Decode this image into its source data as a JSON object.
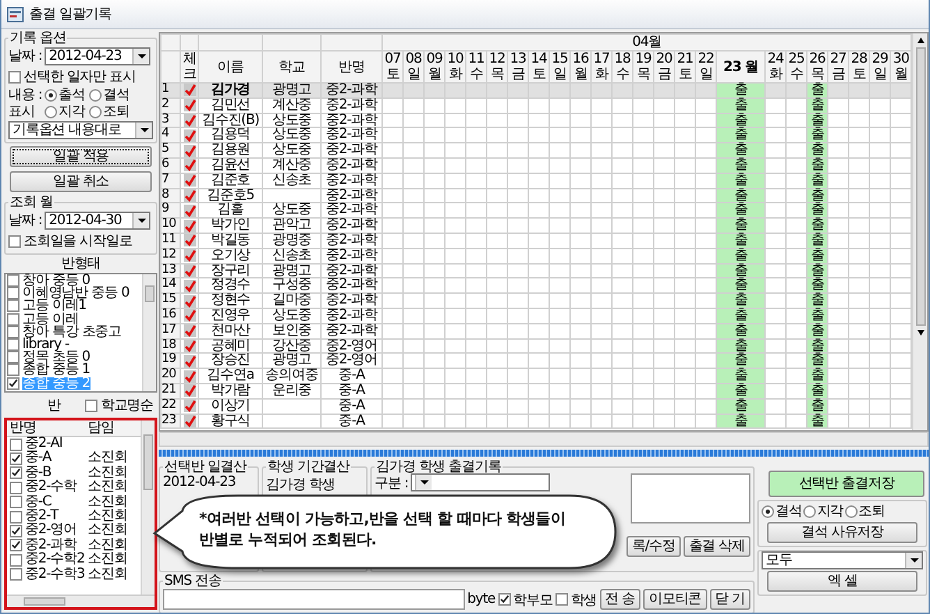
{
  "window": {
    "title": "출결 일괄기록"
  },
  "record_options": {
    "title": "기록 옵션",
    "date_label": "날짜 :",
    "date": "2012-04-23",
    "only_selected": {
      "label": "선택한 일자만 표시",
      "checked": false
    },
    "content_label": "내용 :",
    "display_label": "표시",
    "radios": [
      {
        "label": "출석",
        "selected": true
      },
      {
        "label": "결석",
        "selected": false
      },
      {
        "label": "지각",
        "selected": false
      },
      {
        "label": "조퇴",
        "selected": false
      }
    ],
    "mode": "기록옵션 내용대로"
  },
  "batch_buttons": [
    {
      "label": "일괄 적용",
      "focused": true
    },
    {
      "label": "일괄 취소",
      "focused": false
    }
  ],
  "query_month": {
    "title": "조회 월",
    "date_label": "날짜 :",
    "date": "2012-04-30",
    "start_option": {
      "label": "조회일을 시작일로",
      "checked": false
    }
  },
  "class_types": {
    "title": "반형태",
    "items": [
      {
        "label": "창아 중등 0",
        "checked": false,
        "selected": false
      },
      {
        "label": "이혜영남반 중등 0",
        "checked": false,
        "selected": false
      },
      {
        "label": "고등 이레1",
        "checked": false,
        "selected": false
      },
      {
        "label": "고등 이레",
        "checked": false,
        "selected": false
      },
      {
        "label": "창아 특강 초중고",
        "checked": false,
        "selected": false
      },
      {
        "label": "library -",
        "checked": false,
        "selected": false
      },
      {
        "label": "정목 초등 0",
        "checked": false,
        "selected": false
      },
      {
        "label": "종합 중등 1",
        "checked": false,
        "selected": false
      },
      {
        "label": "종합 중등 2",
        "checked": true,
        "selected": true
      }
    ]
  },
  "class_label": "반",
  "school_sort": {
    "label": "학교명순",
    "checked": false
  },
  "class_list": {
    "columns": [
      "반명",
      "담임"
    ],
    "rows": [
      {
        "name": "중2-AI",
        "checked": false
      },
      {
        "name": "중-A",
        "teacher": "소진회",
        "checked": true
      },
      {
        "name": "중-B",
        "teacher": "소진회",
        "checked": true
      },
      {
        "name": "중2-수학",
        "teacher": "소진회",
        "checked": false
      },
      {
        "name": "중-C",
        "teacher": "소진회",
        "checked": false
      },
      {
        "name": "중2-T",
        "teacher": "소진회",
        "checked": false
      },
      {
        "name": "중2-영어",
        "teacher": "소진회",
        "checked": true
      },
      {
        "name": "중2-과학",
        "teacher": "소진회",
        "checked": true
      },
      {
        "name": "중2-수학2",
        "teacher": "소진회",
        "checked": false
      },
      {
        "name": "중2-수학3",
        "teacher": "소진회",
        "checked": false
      }
    ]
  },
  "grid": {
    "month": "04월",
    "columns": [
      "체크",
      "이름",
      "학교",
      "반명"
    ],
    "days": [
      {
        "date": "07",
        "weekday": "토",
        "selected": false
      },
      {
        "date": "08",
        "weekday": "일",
        "selected": false
      },
      {
        "date": "09",
        "weekday": "월",
        "selected": false
      },
      {
        "date": "10",
        "weekday": "화",
        "selected": false
      },
      {
        "date": "11",
        "weekday": "수",
        "selected": false
      },
      {
        "date": "12",
        "weekday": "목",
        "selected": false
      },
      {
        "date": "13",
        "weekday": "금",
        "selected": false
      },
      {
        "date": "14",
        "weekday": "토",
        "selected": false
      },
      {
        "date": "15",
        "weekday": "일",
        "selected": false
      },
      {
        "date": "16",
        "weekday": "월",
        "selected": false
      },
      {
        "date": "17",
        "weekday": "화",
        "selected": false
      },
      {
        "date": "18",
        "weekday": "수",
        "selected": false
      },
      {
        "date": "19",
        "weekday": "목",
        "selected": false
      },
      {
        "date": "20",
        "weekday": "금",
        "selected": false
      },
      {
        "date": "21",
        "weekday": "토",
        "selected": false
      },
      {
        "date": "22",
        "weekday": "일",
        "selected": false
      },
      {
        "date": "23",
        "weekday": "월",
        "selected": true
      },
      {
        "date": "24",
        "weekday": "화",
        "selected": false
      },
      {
        "date": "25",
        "weekday": "수",
        "selected": false
      },
      {
        "date": "26",
        "weekday": "목",
        "selected": false
      },
      {
        "date": "27",
        "weekday": "금",
        "selected": false
      },
      {
        "date": "28",
        "weekday": "토",
        "selected": false
      },
      {
        "date": "29",
        "weekday": "일",
        "selected": false
      },
      {
        "date": "30",
        "weekday": "월",
        "selected": false
      }
    ],
    "rows": [
      {
        "number": "1",
        "checked": true,
        "name": "김가경",
        "school": "광명고",
        "class": "중2-과학",
        "selected": true,
        "cells": [
          null,
          null,
          null,
          null,
          null,
          null,
          null,
          null,
          null,
          null,
          null,
          null,
          null,
          null,
          null,
          null,
          "출",
          null,
          null,
          "출",
          null,
          null,
          null,
          null
        ]
      },
      {
        "number": "2",
        "checked": true,
        "name": "김민선",
        "school": "계산중",
        "class": "중2-과학",
        "selected": false,
        "cells": [
          null,
          null,
          null,
          null,
          null,
          null,
          null,
          null,
          null,
          null,
          null,
          null,
          null,
          null,
          null,
          null,
          "출",
          null,
          null,
          "출",
          null,
          null,
          null,
          null
        ]
      },
      {
        "number": "3",
        "checked": true,
        "name": "김수진(B)",
        "school": "상도중",
        "class": "중2-과학",
        "selected": false,
        "cells": [
          null,
          null,
          null,
          null,
          null,
          null,
          null,
          null,
          null,
          null,
          null,
          null,
          null,
          null,
          null,
          null,
          "출",
          null,
          null,
          "출",
          null,
          null,
          null,
          null
        ]
      },
      {
        "number": "4",
        "checked": true,
        "name": "김용덕",
        "school": "상도중",
        "class": "중2-과학",
        "selected": false,
        "cells": [
          null,
          null,
          null,
          null,
          null,
          null,
          null,
          null,
          null,
          null,
          null,
          null,
          null,
          null,
          null,
          null,
          "출",
          null,
          null,
          "출",
          null,
          null,
          null,
          null
        ]
      },
      {
        "number": "5",
        "checked": true,
        "name": "김용원",
        "school": "상도중",
        "class": "중2-과학",
        "selected": false,
        "cells": [
          null,
          null,
          null,
          null,
          null,
          null,
          null,
          null,
          null,
          null,
          null,
          null,
          null,
          null,
          null,
          null,
          "출",
          null,
          null,
          "출",
          null,
          null,
          null,
          null
        ]
      },
      {
        "number": "6",
        "checked": true,
        "name": "김윤선",
        "school": "계산중",
        "class": "중2-과학",
        "selected": false,
        "cells": [
          null,
          null,
          null,
          null,
          null,
          null,
          null,
          null,
          null,
          null,
          null,
          null,
          null,
          null,
          null,
          null,
          "출",
          null,
          null,
          "출",
          null,
          null,
          null,
          null
        ]
      },
      {
        "number": "7",
        "checked": true,
        "name": "김준호",
        "school": "신송초",
        "class": "중2-과학",
        "selected": false,
        "cells": [
          null,
          null,
          null,
          null,
          null,
          null,
          null,
          null,
          null,
          null,
          null,
          null,
          null,
          null,
          null,
          null,
          "출",
          null,
          null,
          "출",
          null,
          null,
          null,
          null
        ]
      },
      {
        "number": "8",
        "checked": true,
        "name": "김준호5",
        "class": "중2-과학",
        "selected": false,
        "cells": [
          null,
          null,
          null,
          null,
          null,
          null,
          null,
          null,
          null,
          null,
          null,
          null,
          null,
          null,
          null,
          null,
          "출",
          null,
          null,
          "출",
          null,
          null,
          null,
          null
        ]
      },
      {
        "number": "9",
        "checked": true,
        "name": "김홀",
        "school": "상도중",
        "class": "중2-과학",
        "selected": false,
        "cells": [
          null,
          null,
          null,
          null,
          null,
          null,
          null,
          null,
          null,
          null,
          null,
          null,
          null,
          null,
          null,
          null,
          "출",
          null,
          null,
          "출",
          null,
          null,
          null,
          null
        ]
      },
      {
        "number": "10",
        "checked": true,
        "name": "박가인",
        "school": "관악고",
        "class": "중2-과학",
        "selected": false,
        "cells": [
          null,
          null,
          null,
          null,
          null,
          null,
          null,
          null,
          null,
          null,
          null,
          null,
          null,
          null,
          null,
          null,
          "출",
          null,
          null,
          "출",
          null,
          null,
          null,
          null
        ]
      },
      {
        "number": "11",
        "checked": true,
        "name": "박길동",
        "school": "광명중",
        "class": "중2-과학",
        "selected": false,
        "cells": [
          null,
          null,
          null,
          null,
          null,
          null,
          null,
          null,
          null,
          null,
          null,
          null,
          null,
          null,
          null,
          null,
          "출",
          null,
          null,
          "출",
          null,
          null,
          null,
          null
        ]
      },
      {
        "number": "12",
        "checked": true,
        "name": "오기상",
        "school": "신송초",
        "class": "중2-과학",
        "selected": false,
        "cells": [
          null,
          null,
          null,
          null,
          null,
          null,
          null,
          null,
          null,
          null,
          null,
          null,
          null,
          null,
          null,
          null,
          "출",
          null,
          null,
          "출",
          null,
          null,
          null,
          null
        ]
      },
      {
        "number": "13",
        "checked": true,
        "name": "장구리",
        "school": "광명고",
        "class": "중2-과학",
        "selected": false,
        "cells": [
          null,
          null,
          null,
          null,
          null,
          null,
          null,
          null,
          null,
          null,
          null,
          null,
          null,
          null,
          null,
          null,
          "출",
          null,
          null,
          "출",
          null,
          null,
          null,
          null
        ]
      },
      {
        "number": "14",
        "checked": true,
        "name": "정경수",
        "school": "구성중",
        "class": "중2-과학",
        "selected": false,
        "cells": [
          null,
          null,
          null,
          null,
          null,
          null,
          null,
          null,
          null,
          null,
          null,
          null,
          null,
          null,
          null,
          null,
          "출",
          null,
          null,
          "출",
          null,
          null,
          null,
          null
        ]
      },
      {
        "number": "15",
        "checked": true,
        "name": "정현수",
        "school": "길마중",
        "class": "중2-과학",
        "selected": false,
        "cells": [
          null,
          null,
          null,
          null,
          null,
          null,
          null,
          null,
          null,
          null,
          null,
          null,
          null,
          null,
          null,
          null,
          "출",
          null,
          null,
          "출",
          null,
          null,
          null,
          null
        ]
      },
      {
        "number": "16",
        "checked": true,
        "name": "진영우",
        "school": "상도중",
        "class": "중2-과학",
        "selected": false,
        "cells": [
          null,
          null,
          null,
          null,
          null,
          null,
          null,
          null,
          null,
          null,
          null,
          null,
          null,
          null,
          null,
          null,
          "출",
          null,
          null,
          "출",
          null,
          null,
          null,
          null
        ]
      },
      {
        "number": "17",
        "checked": true,
        "name": "천마산",
        "school": "보인중",
        "class": "중2-과학",
        "selected": false,
        "cells": [
          null,
          null,
          null,
          null,
          null,
          null,
          null,
          null,
          null,
          null,
          null,
          null,
          null,
          null,
          null,
          null,
          "출",
          null,
          null,
          "출",
          null,
          null,
          null,
          null
        ]
      },
      {
        "number": "18",
        "checked": true,
        "name": "공혜미",
        "school": "강산중",
        "class": "중2-영어",
        "selected": false,
        "cells": [
          null,
          null,
          null,
          null,
          null,
          null,
          null,
          null,
          null,
          null,
          null,
          null,
          null,
          null,
          null,
          null,
          "출",
          null,
          null,
          "출",
          null,
          null,
          null,
          null
        ]
      },
      {
        "number": "19",
        "checked": true,
        "name": "장승진",
        "school": "광명고",
        "class": "중2-영어",
        "selected": false,
        "cells": [
          null,
          null,
          null,
          null,
          null,
          null,
          null,
          null,
          null,
          null,
          null,
          null,
          null,
          null,
          null,
          null,
          "출",
          null,
          null,
          "출",
          null,
          null,
          null,
          null
        ]
      },
      {
        "number": "20",
        "checked": true,
        "name": "김수연a",
        "school": "송의여중",
        "class": "중-A",
        "selected": false,
        "cells": [
          null,
          null,
          null,
          null,
          null,
          null,
          null,
          null,
          null,
          null,
          null,
          null,
          null,
          null,
          null,
          null,
          "출",
          null,
          null,
          "출",
          null,
          null,
          null,
          null
        ]
      },
      {
        "number": "21",
        "checked": true,
        "name": "박가람",
        "school": "운리중",
        "class": "중-A",
        "selected": false,
        "cells": [
          null,
          null,
          null,
          null,
          null,
          null,
          null,
          null,
          null,
          null,
          null,
          null,
          null,
          null,
          null,
          null,
          "출",
          null,
          null,
          "출",
          null,
          null,
          null,
          null
        ]
      },
      {
        "number": "22",
        "checked": true,
        "name": "이상기",
        "class": "중-A",
        "selected": false,
        "cells": [
          null,
          null,
          null,
          null,
          null,
          null,
          null,
          null,
          null,
          null,
          null,
          null,
          null,
          null,
          null,
          null,
          "출",
          null,
          null,
          "출",
          null,
          null,
          null,
          null
        ]
      },
      {
        "number": "23",
        "checked": true,
        "name": "황구식",
        "class": "중-A",
        "selected": false,
        "cells": [
          null,
          null,
          null,
          null,
          null,
          null,
          null,
          null,
          null,
          null,
          null,
          null,
          null,
          null,
          null,
          null,
          "출",
          null,
          null,
          "출",
          null,
          null,
          null,
          null
        ]
      }
    ]
  },
  "progress": {
    "level": 1
  },
  "daily_summary": {
    "title": "선택반 일결산",
    "date": "2012-04-23"
  },
  "period_summary": {
    "title": "학생 기간결산",
    "student": "김가경 학생"
  },
  "record": {
    "title": "김가경 학생 출결기록",
    "category_label": "구분 :",
    "buttons": [
      "록/수정",
      "출결 삭제"
    ]
  },
  "callout": "*여러반 선택이 가능하고,반을 선택 할 때마다 학생들이\n반별로 누적되어 조회된다.",
  "sms": {
    "title": "SMS 전송",
    "byte_label": "byte",
    "recipients": [
      {
        "label": "학부모",
        "checked": true
      },
      {
        "label": "학생",
        "checked": false
      }
    ],
    "buttons": [
      "전 송",
      "이모티콘",
      "닫 기"
    ]
  },
  "side": {
    "save_button": "선택반 출결저장",
    "reasons": [
      {
        "label": "결석",
        "selected": true
      },
      {
        "label": "지각",
        "selected": false
      },
      {
        "label": "조퇴",
        "selected": false
      }
    ],
    "reason_button": "결석 사유저장",
    "filter": "모두",
    "excel_button": "엑 셀"
  }
}
